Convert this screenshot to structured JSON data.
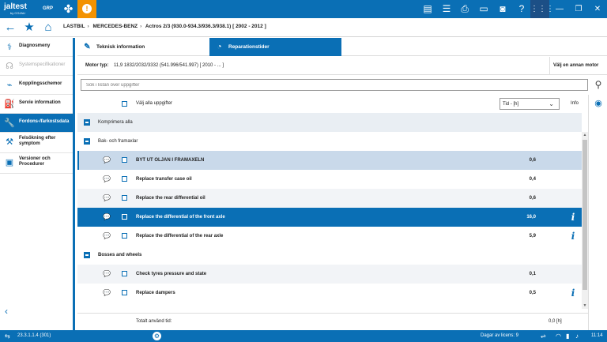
{
  "brand": {
    "logo": "jaltest",
    "logo_sub": "by COJALI",
    "grp": "GRP"
  },
  "breadcrumb": [
    "LASTBIL",
    "MERCEDES-BENZ",
    "Actros 2/3 (930.0-934.3/936.3/938.1) [ 2002 - 2012 ]"
  ],
  "sidebar": {
    "items": [
      {
        "label": "Diagnosmeny",
        "icon": "stethoscope-icon",
        "state": "normal"
      },
      {
        "label": "Systemspecifikationer",
        "icon": "headset-icon",
        "state": "disabled"
      },
      {
        "label": "Kopplingsschemor",
        "icon": "wiring-icon",
        "state": "normal"
      },
      {
        "label": "Servie information",
        "icon": "oil-can-icon",
        "state": "normal"
      },
      {
        "label": "Fordons-/farkostsdata",
        "icon": "wrench-icon",
        "state": "active"
      },
      {
        "label": "Felsökning efter symptom",
        "icon": "troubleshoot-icon",
        "state": "normal"
      },
      {
        "label": "Versioner och Procedurer",
        "icon": "document-icon",
        "state": "normal"
      }
    ]
  },
  "tabs": [
    {
      "label": "Teknisk information"
    },
    {
      "label": "Reparationstider"
    }
  ],
  "motor": {
    "label": "Motor typ:",
    "value": "11,9 1832/2032/3332 (541.996/541.997) [ 2010 - ... ]",
    "alt": "Välj en annan motor"
  },
  "search": {
    "placeholder": "Sök i listan över uppgifter"
  },
  "table_header": {
    "select_all": "Välj alla uppgifter",
    "unit_select": "Tid - [h]",
    "info": "Info"
  },
  "compress_all": "Komprimera alla",
  "groups": [
    {
      "label": "Bak- och framaxlar"
    },
    {
      "label": "Bosses and wheels"
    }
  ],
  "tasks": [
    {
      "label": "BYT UT OLJAN I FRAMAXELN",
      "time": "0,6",
      "has_info": false
    },
    {
      "label": "Replace transfer case oil",
      "time": "0,4",
      "has_info": false
    },
    {
      "label": "Replace the rear differential oil",
      "time": "0,6",
      "has_info": false
    },
    {
      "label": "Replace the differential of the front axle",
      "time": "16,0",
      "has_info": true
    },
    {
      "label": "Replace the differential of the rear axle",
      "time": "5,9",
      "has_info": true
    },
    {
      "label": "Check tyres pressure and state",
      "time": "0,1",
      "has_info": false
    },
    {
      "label": "Replace dampers",
      "time": "0,5",
      "has_info": true
    }
  ],
  "total": {
    "label": "Totalt använd tid:",
    "value": "0,0 [h]"
  },
  "status": {
    "version": "23.3.1.1.4 (301)",
    "license": "Dagar av licens: 9",
    "time": "11:14"
  },
  "colors": {
    "primary": "#0a6fb5",
    "warning": "#f39200",
    "dark": "#1c4f86"
  }
}
